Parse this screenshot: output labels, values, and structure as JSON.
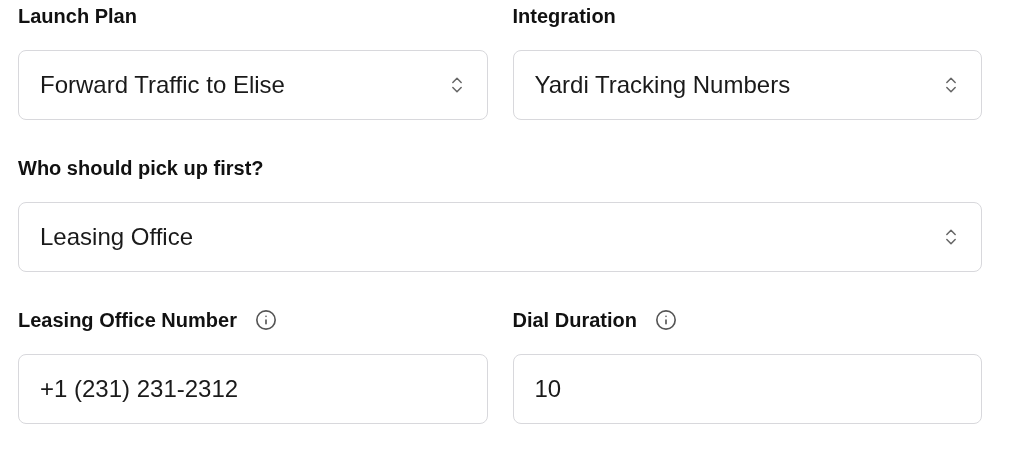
{
  "rows": [
    [
      {
        "kind": "select",
        "label": "Launch Plan",
        "info": false,
        "value": "Forward Traffic to Elise"
      },
      {
        "kind": "select",
        "label": "Integration",
        "info": false,
        "value": "Yardi Tracking Numbers"
      }
    ],
    [
      {
        "kind": "select",
        "label": "Who should pick up first?",
        "info": false,
        "value": "Leasing Office"
      }
    ],
    [
      {
        "kind": "input",
        "label": "Leasing Office Number",
        "info": true,
        "value": "+1 (231) 231-2312"
      },
      {
        "kind": "input",
        "label": "Dial Duration",
        "info": true,
        "value": "10"
      }
    ]
  ]
}
